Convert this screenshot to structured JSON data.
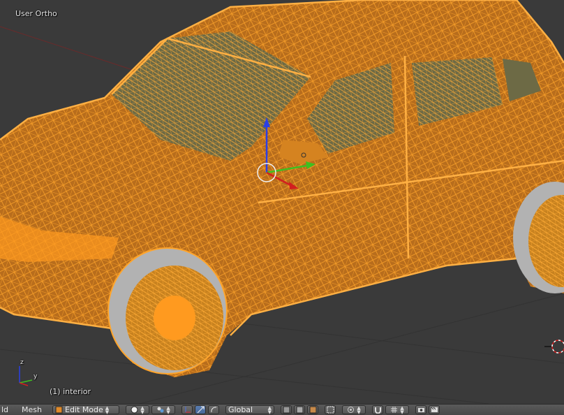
{
  "viewport": {
    "view_name": "User Ortho",
    "object_info": "(1) interior",
    "axis_labels": {
      "z": "z",
      "y": "y"
    },
    "colors": {
      "background": "#3a3a3a",
      "wire": "#ff9a1f",
      "glass": "#6d6a45",
      "body": "#c97a22",
      "x_axis": "#d21f1f",
      "y_axis": "#3fbf20",
      "z_axis": "#2b3fe6"
    }
  },
  "header": {
    "editor_fragment": "ld",
    "mesh_menu": "Mesh",
    "mode": "Edit Mode",
    "orientation": "Global",
    "icons": [
      "mode-icon",
      "viewport-shading-icon",
      "pivot-icon",
      "manipulator-icon",
      "translate-icon",
      "rotate-icon",
      "vertex-select-icon",
      "edge-select-icon",
      "face-select-icon",
      "occlude-icon",
      "proportional-icon",
      "snap-magnet-icon",
      "snap-grid-icon",
      "opengl-render-icon",
      "opengl-anim-icon"
    ]
  }
}
